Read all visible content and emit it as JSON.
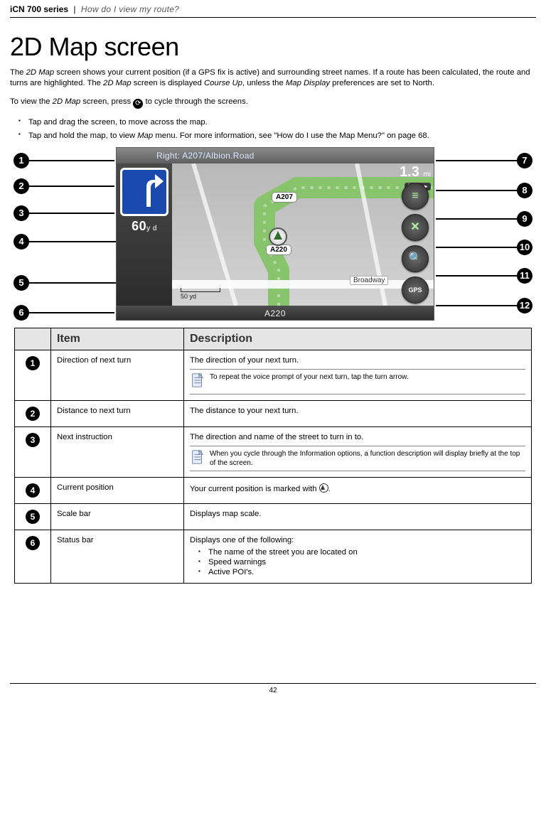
{
  "header": {
    "series": "iCN 700 series",
    "sep": "|",
    "breadcrumb": "How do I view my route?"
  },
  "title": "2D Map screen",
  "intro_html": "The <em>2D Map</em> screen shows your current position (if a GPS fix is active) and surrounding street names. If a route has been calculated, the route and turns are highlighted. The <em>2D Map</em> screen is displayed <em>Course Up</em>, unless the <em>Map Display</em> preferences are set to North.",
  "to_view_pre": "To view the ",
  "to_view_em": "2D Map",
  "to_view_mid": " screen, press ",
  "to_view_post": " to cycle through the screens.",
  "bullets": [
    "Tap and drag the screen, to move across the map.",
    "Tap and hold the map, to view <em>Map</em> menu. For more information, see \"How do I use the Map Menu?\" on page 68."
  ],
  "figure": {
    "top_instruction": "Right: A207/Albion.Road",
    "turn_distance_value": "60",
    "turn_distance_unit": "y d",
    "dtg_value": "1.3",
    "dtg_unit": "mi",
    "dtg_label": "DTG ▸",
    "shields": [
      "A207",
      "A220"
    ],
    "street_label": "Broadway",
    "scale_label": "50 yd",
    "bottom_street": "A220",
    "side_buttons": [
      "≡",
      "✕",
      "🔍",
      "GPS"
    ],
    "callouts_left": [
      "1",
      "2",
      "3",
      "4",
      "5",
      "6"
    ],
    "callouts_right": [
      "7",
      "8",
      "9",
      "10",
      "11",
      "12"
    ]
  },
  "table": {
    "head_item": "Item",
    "head_desc": "Description",
    "rows": [
      {
        "n": "1",
        "item": "Direction of next turn",
        "desc": "The direction of your next turn.",
        "note": "To repeat the voice prompt of your next turn, tap the turn arrow."
      },
      {
        "n": "2",
        "item": "Distance to next turn",
        "desc": "The distance to your next turn."
      },
      {
        "n": "3",
        "item": "Next instruction",
        "desc": "The direction and name of the street to turn in to.",
        "note": "When you cycle through the Information options, a function description will display briefly at the top of the screen."
      },
      {
        "n": "4",
        "item": "Current position",
        "desc_pre": "Your current position is marked with ",
        "desc_post": "."
      },
      {
        "n": "5",
        "item": "Scale bar",
        "desc": "Displays map scale."
      },
      {
        "n": "6",
        "item": "Status bar",
        "desc": "Displays one of the following:",
        "sub": [
          "The name of the street you are located on",
          "Speed warnings",
          "Active POI's."
        ]
      }
    ]
  },
  "page_number": "42"
}
